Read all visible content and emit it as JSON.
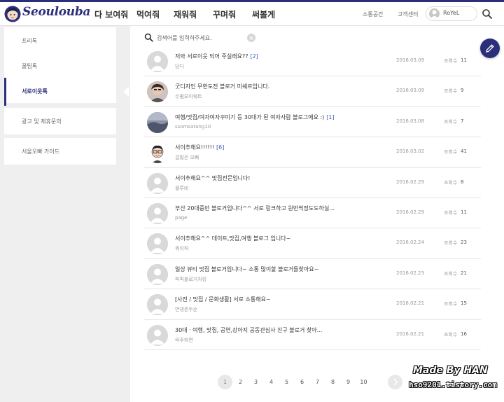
{
  "brand": {
    "logo_text": "Seoulouba"
  },
  "nav": {
    "items": [
      "다 보여줘",
      "먹여줘",
      "재워줘",
      "꾸며줘",
      "써볼게"
    ]
  },
  "util": {
    "community": "소통공간",
    "support": "고객센터",
    "user_name": "RoYeL"
  },
  "sidebar": {
    "items": [
      "프리톡",
      "꿀팁톡",
      "서로이웃톡"
    ],
    "active": "서로이웃톡",
    "extra": [
      "광고 및 제휴문의",
      "서울오빠 가이드"
    ]
  },
  "search": {
    "placeholder": "검색어를 입력하주세요."
  },
  "views_label": "조회수",
  "posts": [
    {
      "title": "저와 서로이웃 되어 주실래요??",
      "replies": "[2]",
      "author": "담다",
      "date": "2016.03.09",
      "views": "11",
      "avatar": "default"
    },
    {
      "title": "굿디자인 무한도전 블로거 미쉐르입니다.",
      "replies": "",
      "author": "수펌모이쉐트",
      "date": "2016.03.09",
      "views": "9",
      "avatar": "photo"
    },
    {
      "title": "여행/맛집/여자여자꾸미기 등 30대가 된 여자사람 블로그에요 :)",
      "replies": "[1]",
      "author": "ssomsatang10",
      "date": "2016.03.08",
      "views": "7",
      "avatar": "landscape"
    },
    {
      "title": "서이추해요!!!!!!",
      "replies": "[6]",
      "author": "겁많은 오빠",
      "date": "2016.03.02",
      "views": "41",
      "avatar": "cartoon"
    },
    {
      "title": "서이추해요^^ 맛집전문입니다!",
      "replies": "",
      "author": "플루비",
      "date": "2016.02.29",
      "views": "8",
      "avatar": "default"
    },
    {
      "title": "부산 20대중반 블로거입니다^^ 서로 링크하고 원번씩정도도하실...",
      "replies": "",
      "author": "page",
      "date": "2016.02.29",
      "views": "11",
      "avatar": "default"
    },
    {
      "title": "서이추해요^^ 데이트,맛집,여행 블로그 입니다~",
      "replies": "",
      "author": "쿼이허",
      "date": "2016.02.24",
      "views": "23",
      "avatar": "default"
    },
    {
      "title": "일상 뷰티 맛집 블로거입니다~ 소통 많이할 블로거들찾아요~",
      "replies": "",
      "author": "파픽블로거처킹",
      "date": "2016.02.23",
      "views": "21",
      "avatar": "default"
    },
    {
      "title": "[사진 / 맛집 / 문화생활] 서로 소통해요~",
      "replies": "",
      "author": "연넹존두순",
      "date": "2016.02.21",
      "views": "15",
      "avatar": "default"
    },
    {
      "title": "30대 · 여행, 맛집, 공연,강아지 공동관심사 친구 블로거 찾아...",
      "replies": "",
      "author": "락주하면",
      "date": "2016.02.21",
      "views": "16",
      "avatar": "default"
    }
  ],
  "pagination": {
    "pages": [
      "1",
      "2",
      "3",
      "4",
      "5",
      "6",
      "7",
      "8",
      "9",
      "10"
    ],
    "current": "1"
  },
  "watermark": {
    "line1": "Made By HAN",
    "line2": "hso9201.tistory.com"
  },
  "colors": {
    "brand": "#2b2f7a",
    "reply_count": "#3a5fbf",
    "background": "#efefef"
  },
  "icons": {
    "search": "search-icon",
    "write": "pencil-icon",
    "clear": "clear-icon",
    "next": "chevron-right-icon"
  }
}
